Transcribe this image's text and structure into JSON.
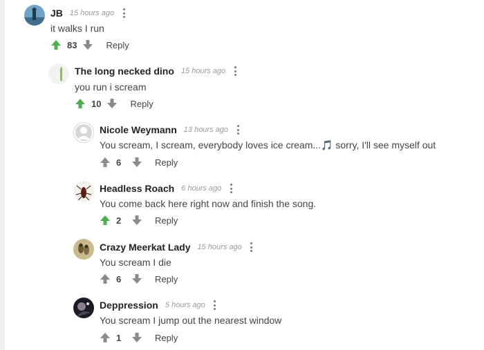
{
  "comments": [
    {
      "author": "JB",
      "time": "15 hours ago",
      "text": "it walks I run",
      "score": "83",
      "reply": "Reply",
      "upvoted": true
    },
    {
      "author": "The long necked dino",
      "time": "15 hours ago",
      "text": "you run i scream",
      "score": "10",
      "reply": "Reply",
      "upvoted": true
    },
    {
      "author": "Nicole Weymann",
      "time": "13 hours ago",
      "text": "You scream, I scream, everybody loves ice cream...🎵 sorry, I'll see myself out",
      "score": "6",
      "reply": "Reply",
      "upvoted": false
    },
    {
      "author": "Headless Roach",
      "time": "6 hours ago",
      "text": "You come back here right now and finish the song.",
      "score": "2",
      "reply": "Reply",
      "upvoted": true
    },
    {
      "author": "Crazy Meerkat Lady",
      "time": "15 hours ago",
      "text": "You scream I die",
      "score": "6",
      "reply": "Reply",
      "upvoted": false
    },
    {
      "author": "Deppression",
      "time": "5 hours ago",
      "text": "You scream I jump out the nearest window",
      "score": "1",
      "reply": "Reply",
      "upvoted": false
    }
  ],
  "colors": {
    "upvote_active": "#4caf50",
    "vote_inactive": "#8a8a8a"
  }
}
